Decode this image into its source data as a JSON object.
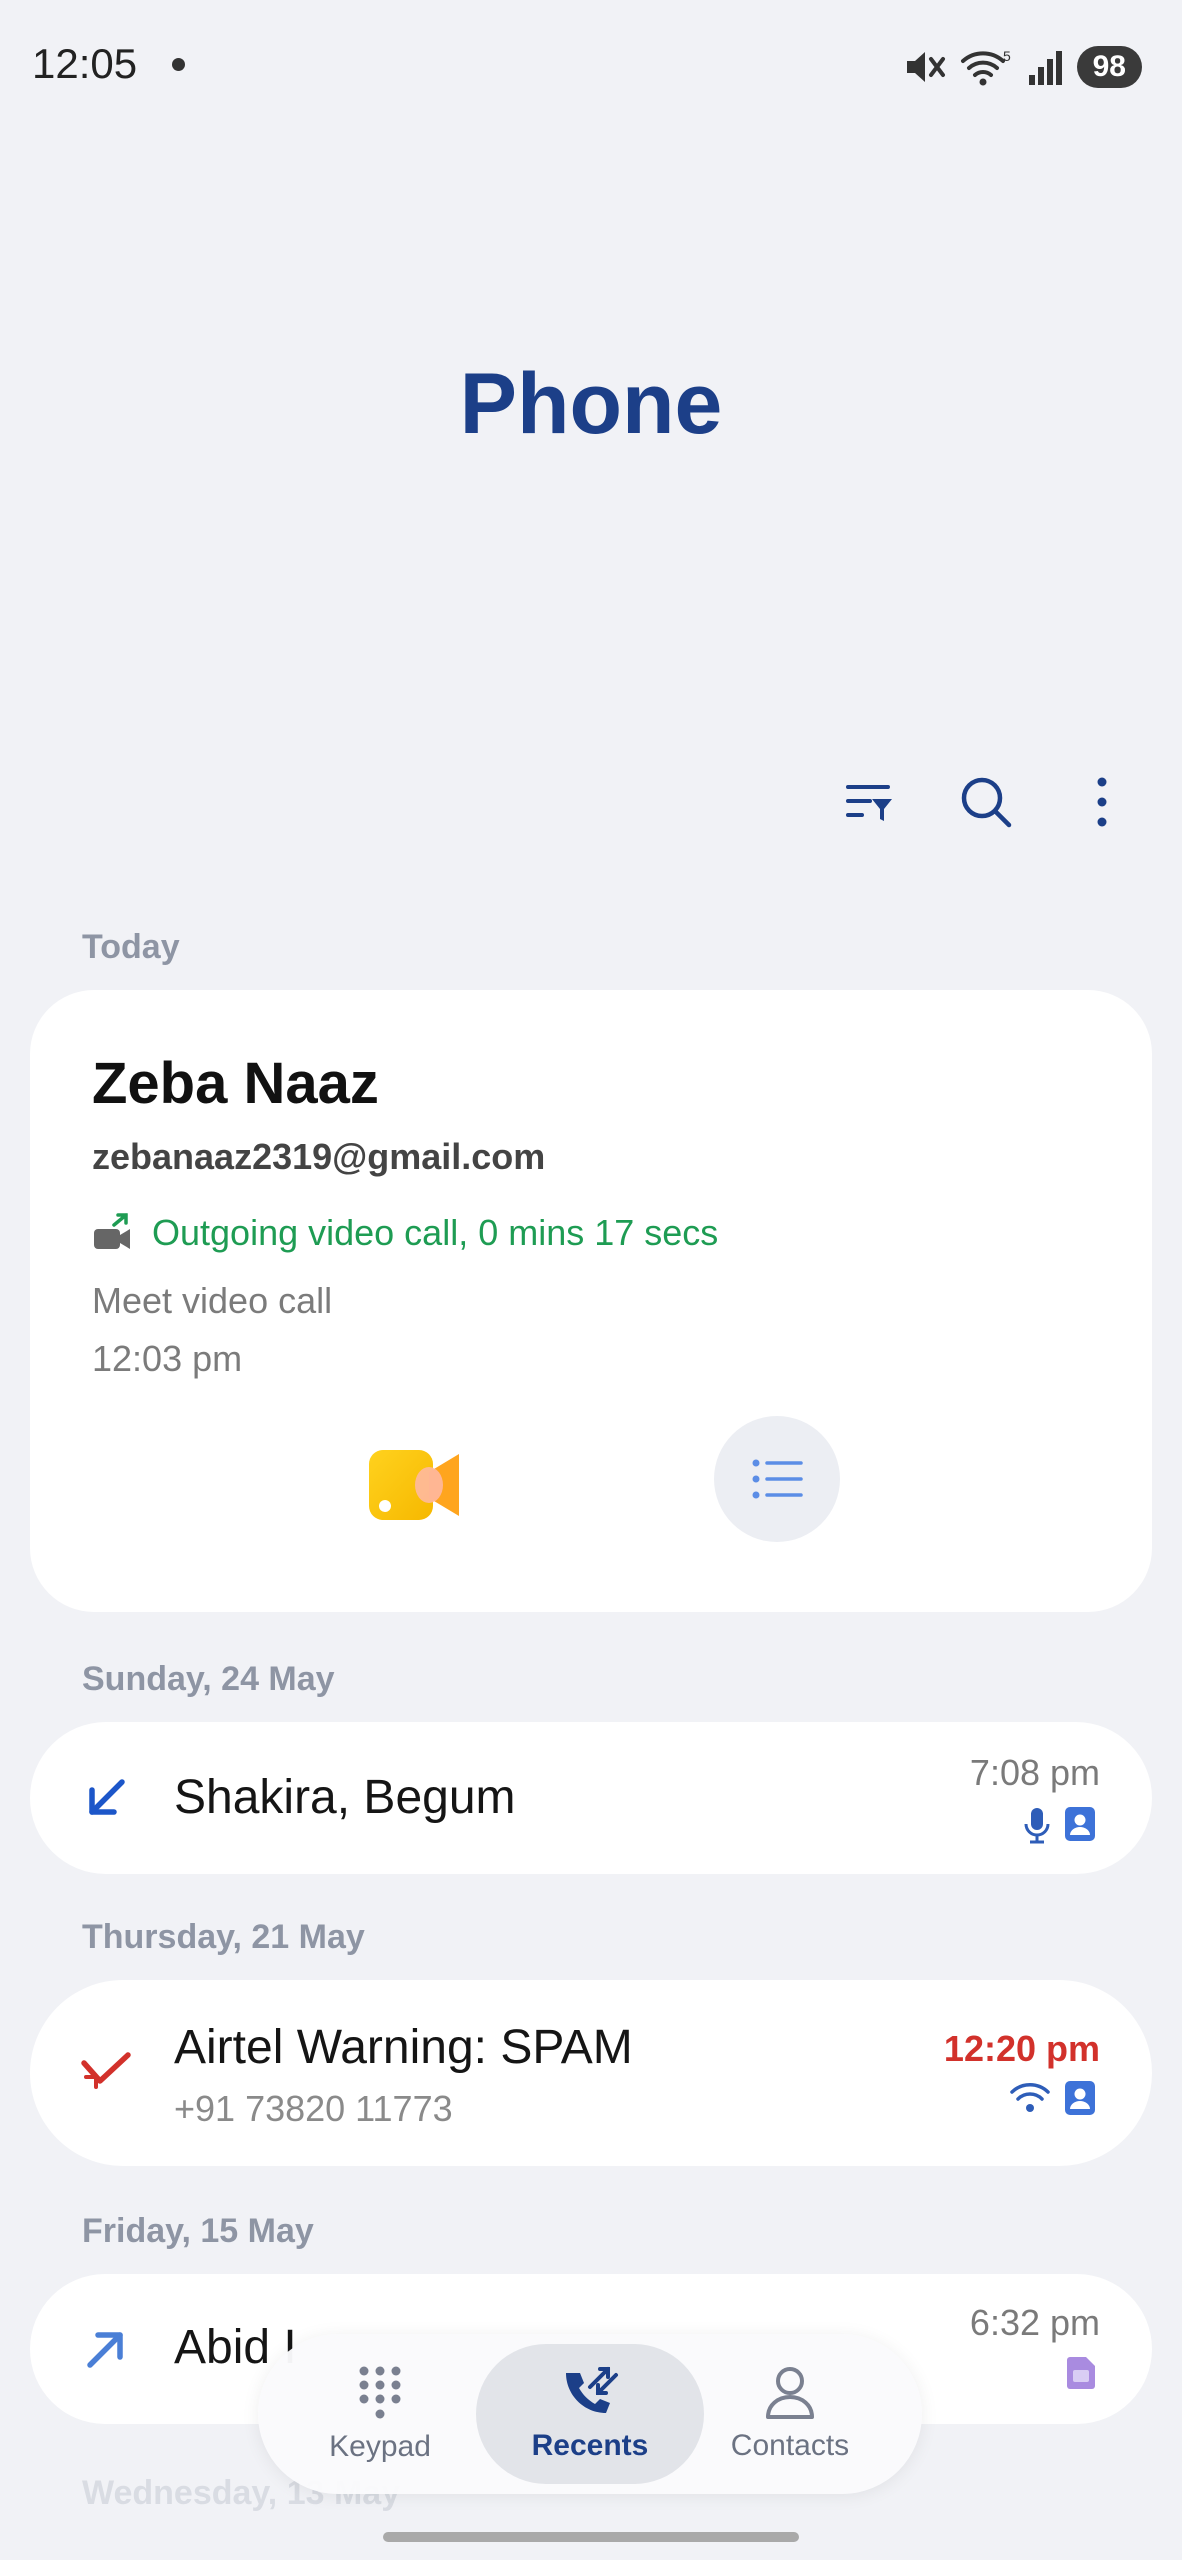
{
  "status_bar": {
    "time": "12:05",
    "battery": "98",
    "wifi_label": "5"
  },
  "header": {
    "title": "Phone"
  },
  "toolbar": {
    "icons": [
      "filter-icon",
      "search-icon",
      "more-options-icon"
    ]
  },
  "sections": {
    "today": "Today",
    "sunday": "Sunday, 24 May",
    "thursday": "Thursday, 21 May",
    "friday": "Friday, 15 May",
    "wednesday": "Wednesday, 13 May"
  },
  "featured_call": {
    "name": "Zeba Naaz",
    "email": "zebanaaz2319@gmail.com",
    "call_info": "Outgoing video call, 0 mins 17 secs",
    "service": "Meet video call",
    "time": "12:03 pm"
  },
  "calls": [
    {
      "name": "Shakira, Begum",
      "number": "",
      "time": "7:08 pm",
      "direction": "incoming"
    },
    {
      "name": "Airtel Warning: SPAM",
      "number": "+91 73820 11773",
      "time": "12:20 pm",
      "direction": "missed"
    },
    {
      "name": "Abid I",
      "number": "",
      "time": "6:32 pm",
      "direction": "outgoing"
    }
  ],
  "bottom_nav": {
    "keypad": "Keypad",
    "recents": "Recents",
    "contacts": "Contacts"
  },
  "colors": {
    "accent": "#1c3f88",
    "outgoing_green": "#1e9c53",
    "missed_red": "#d2312b",
    "background": "#f1f2f6"
  }
}
